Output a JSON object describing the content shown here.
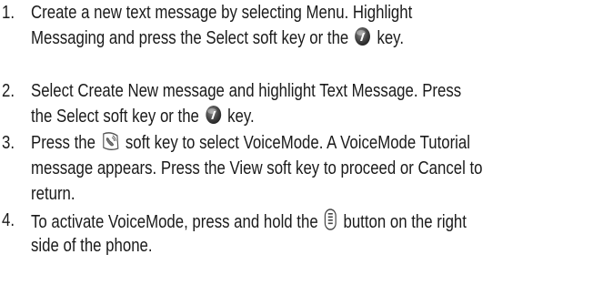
{
  "steps": [
    {
      "number": "1.",
      "line1": "Create a new text message by selecting Menu. Highlight",
      "line2_before": "Messaging and press the Select soft key or the",
      "line2_after": "key.",
      "icon": "info-key-icon"
    },
    {
      "number": "2.",
      "line1": "Select Create New message and highlight Text Message.  Press",
      "line2_before": "the Select soft key or the",
      "line2_after": "key.",
      "icon": "info-key-icon"
    },
    {
      "number": "3.",
      "line1_before": "Press the",
      "line1_after": "soft key to select VoiceMode. A VoiceMode Tutorial",
      "line2": "message appears. Press the View soft key to proceed or Cancel to",
      "line3": "return.",
      "icon": "voicemode-soft-key-icon"
    },
    {
      "number": "4.",
      "line1_before": "To activate VoiceMode, press and hold the",
      "line1_after": "button on the right",
      "line2": "side of the phone.",
      "icon": "side-button-icon"
    }
  ],
  "colors": {
    "text": "#1a1a1a",
    "key_icon_fill": "#3c3c3c"
  }
}
